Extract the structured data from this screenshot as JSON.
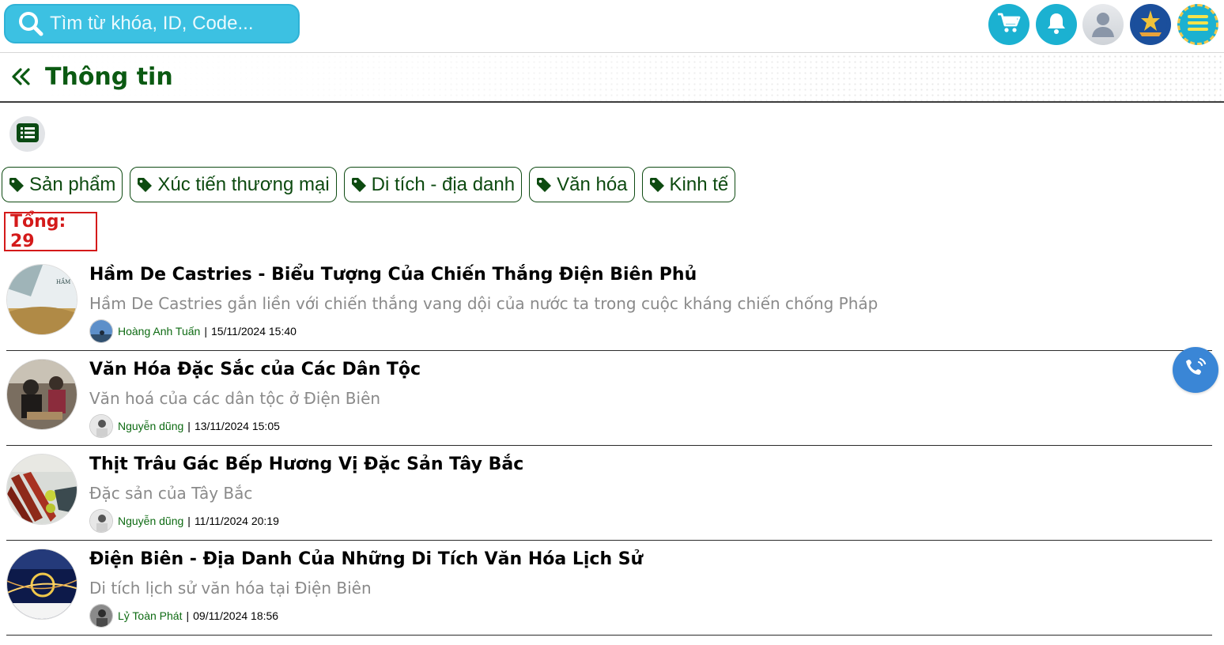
{
  "search": {
    "placeholder": "Tìm từ khóa, ID, Code..."
  },
  "header": {
    "title": "Thông tin"
  },
  "icons": {
    "search": "search-icon",
    "cart": "cart-icon",
    "bell": "bell-icon",
    "user": "user-avatar-icon",
    "logo": "province-logo-icon",
    "menu": "hamburger-menu-icon",
    "back": "double-chevron-left-icon",
    "list": "list-icon",
    "tag": "tag-icon",
    "call": "phone-call-icon"
  },
  "colors": {
    "accent": "#1bb1d1",
    "title_green": "#0b5a12",
    "total_red": "#d41a1a",
    "call_blue": "#3a86d6"
  },
  "tags": [
    {
      "label": "Sản phẩm"
    },
    {
      "label": "Xúc tiến thương mại"
    },
    {
      "label": "Di tích - địa danh"
    },
    {
      "label": "Văn hóa"
    },
    {
      "label": "Kinh tế"
    }
  ],
  "total": {
    "label": "Tổng: 29"
  },
  "posts": [
    {
      "title": "Hầm De Castries - Biểu Tượng Của Chiến Thắng Điện Biên Phủ",
      "description": "Hầm De Castries gắn liền với chiến thắng vang dội của nước ta trong cuộc kháng chiến chống Pháp",
      "author": "Hoàng Anh Tuấn",
      "datetime": "15/11/2024 15:40",
      "thumb_text": "HẦM DE CASTRIES"
    },
    {
      "title": "Văn Hóa Đặc Sắc của Các Dân Tộc",
      "description": "Văn hoá của các dân tộc ở Điện Biên",
      "author": "Nguyễn dũng",
      "datetime": "13/11/2024 15:05"
    },
    {
      "title": "Thịt Trâu Gác Bếp Hương Vị Đặc Sản Tây Bắc",
      "description": "Đặc sản của Tây Bắc",
      "author": "Nguyễn dũng",
      "datetime": "11/11/2024 20:19"
    },
    {
      "title": "Điện Biên - Địa Danh Của Những Di Tích Văn Hóa Lịch Sử",
      "description": "Di tích lịch sử văn hóa tại Điện Biên",
      "author": "Lỷ Toàn Phát",
      "datetime": "09/11/2024 18:56"
    }
  ]
}
